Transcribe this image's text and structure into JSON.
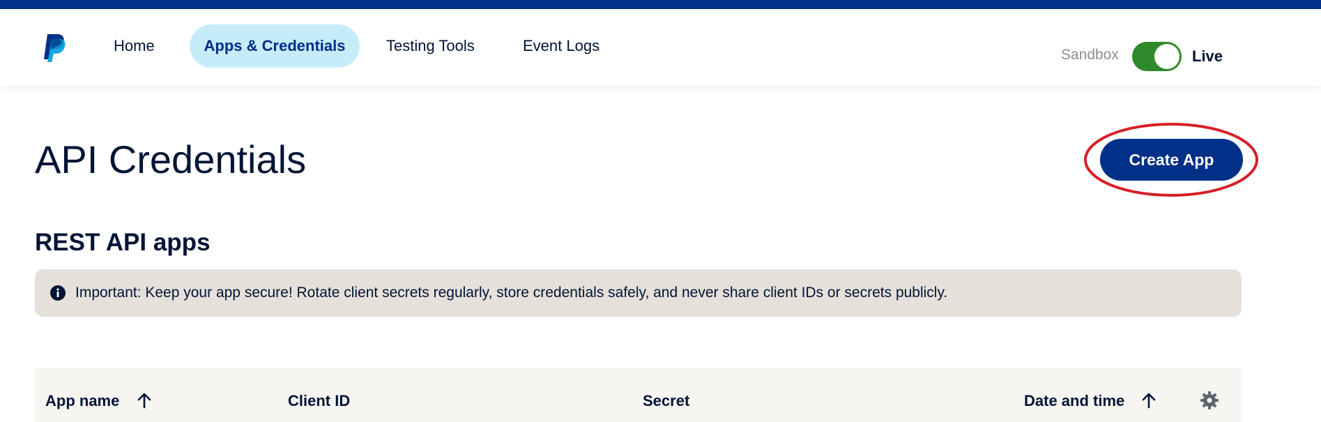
{
  "nav": {
    "items": [
      {
        "label": "Home",
        "active": false
      },
      {
        "label": "Apps & Credentials",
        "active": true
      },
      {
        "label": "Testing Tools",
        "active": false
      },
      {
        "label": "Event Logs",
        "active": false
      }
    ],
    "environment": {
      "sandbox_label": "Sandbox",
      "live_label": "Live",
      "toggle_state": "live"
    }
  },
  "page": {
    "title": "API Credentials",
    "create_button": "Create App",
    "section_title": "REST API apps",
    "notice": {
      "icon": "info-icon",
      "text": "Important: Keep your app secure! Rotate client secrets regularly, store credentials safely, and never share client IDs or secrets publicly."
    }
  },
  "table": {
    "columns": [
      {
        "label": "App name",
        "sortable": true
      },
      {
        "label": "Client ID",
        "sortable": false
      },
      {
        "label": "Secret",
        "sortable": false
      },
      {
        "label": "Date and time",
        "sortable": true
      }
    ],
    "settings_icon": "gear-icon"
  },
  "colors": {
    "brand_dark": "#003087",
    "active_tab_bg": "#c6ecfa",
    "toggle_on": "#2e8a2a",
    "notice_bg": "#e5e0da",
    "highlight_ring": "#d61f26"
  }
}
